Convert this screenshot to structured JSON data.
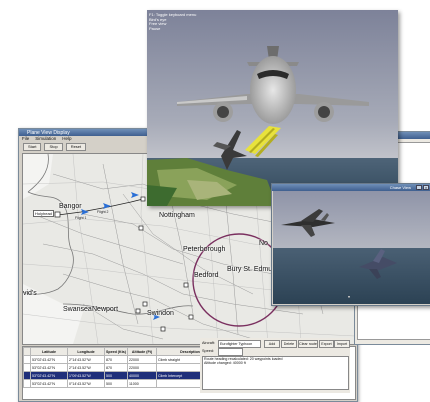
{
  "main_window": {
    "title": "Plane View Display",
    "menu": [
      "File",
      "Simulation",
      "Help"
    ],
    "toolbar": [
      "Start",
      "Stop",
      "Reset"
    ]
  },
  "map": {
    "cities": [
      {
        "name": "Bangor"
      },
      {
        "name": "Nottingham"
      },
      {
        "name": "Peterborough"
      },
      {
        "name": "Bedford"
      },
      {
        "name": "Bury St. Edmunds"
      },
      {
        "name": "Swansea"
      },
      {
        "name": "Newport"
      },
      {
        "name": "Swindon"
      },
      {
        "name": "vid's"
      },
      {
        "name": "Holyhead"
      },
      {
        "name": "No"
      }
    ],
    "aircraft_labels": [
      "Flight 1",
      "Flight 2"
    ]
  },
  "flight_table": {
    "columns": [
      "Latitude",
      "Longitude",
      "Speed (Kts)",
      "Altitude (Ft)",
      "Description"
    ],
    "rows": [
      [
        "53°02'43.42\"N",
        "2°14'43.52\"W",
        "870",
        "22000",
        "Climb straight"
      ],
      [
        "53°02'43.42\"N",
        "2°14'43.52\"W",
        "870",
        "22000",
        ""
      ],
      [
        "53°02'43.42\"N",
        "1°09'43.52\"W",
        "500",
        "40000",
        "Climb Intercept"
      ],
      [
        "53°02'43.42\"N",
        "0°14'43.52\"W",
        "500",
        "11000",
        ""
      ]
    ],
    "selected_row": 2
  },
  "controls": {
    "aircraft_label": "Aircraft:",
    "aircraft_value": "Eurofighter Typhoon",
    "speed_label": "Speed:",
    "buttons": [
      "Add",
      "Delete",
      "Clear route",
      "Export",
      "Import"
    ],
    "log_text": "Route heading recalculated: 20 waypoints loaded\nAltitude changed: 40000 ft"
  },
  "view3d": {
    "info_lines": [
      "F1: Toggle keyboard menu",
      "Bird's eye",
      "Free view",
      "Pause"
    ]
  },
  "view3d_secondary": {
    "title": "Chase View"
  },
  "colors": {
    "titlebar": "#3e5f8f",
    "selection": "#1f2f7a",
    "sky": "#8b91a6",
    "sea": "#3d566b",
    "route_circle": "#7a2f5f"
  }
}
